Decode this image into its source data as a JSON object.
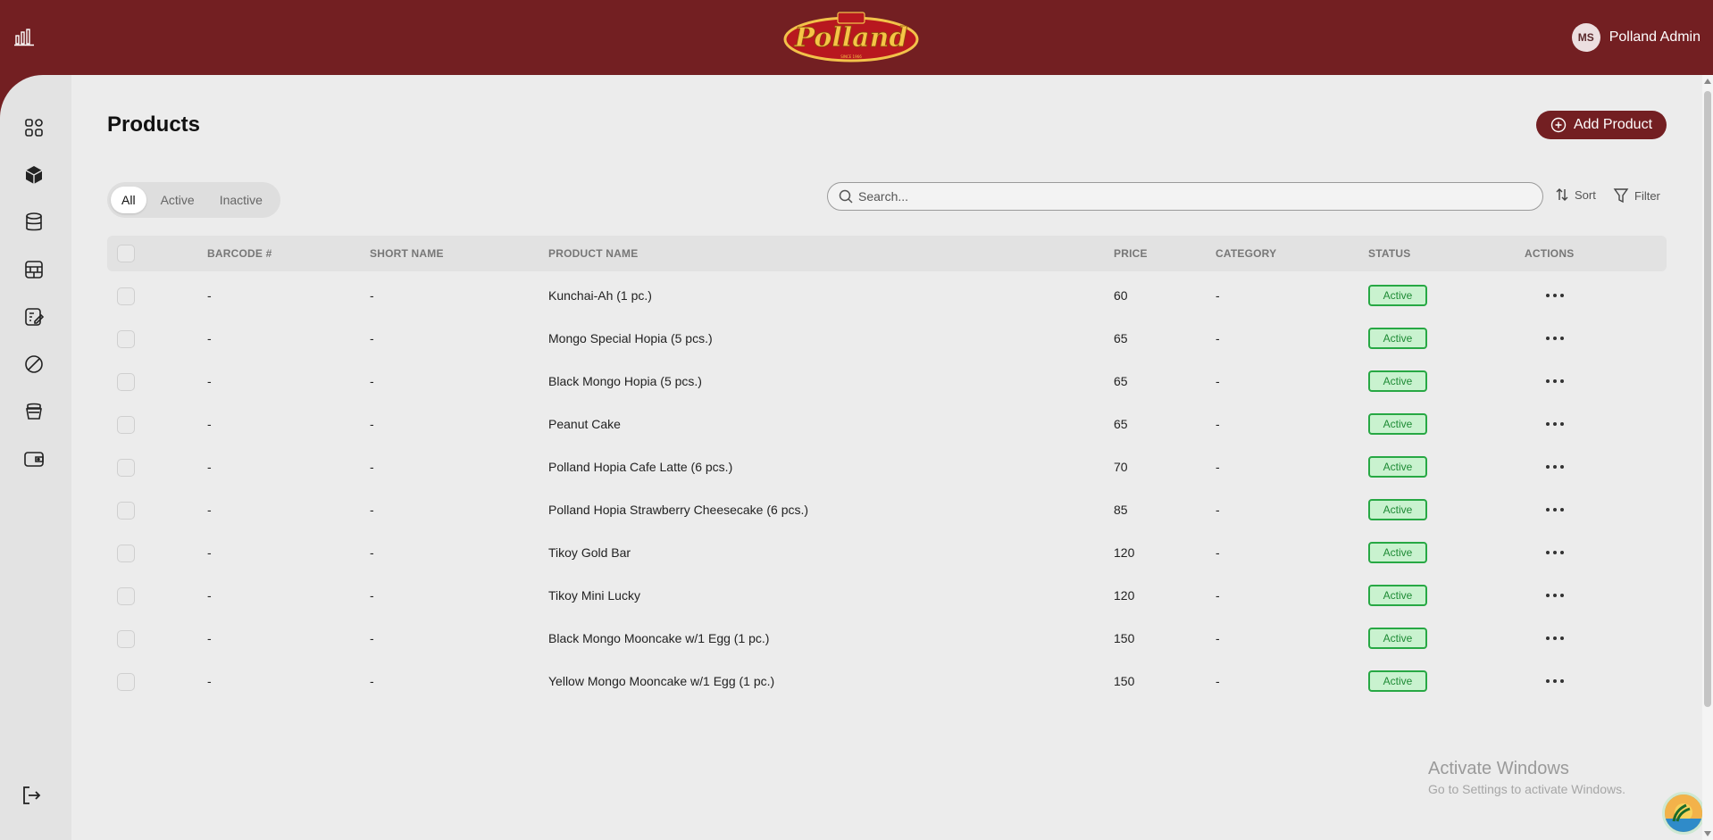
{
  "header": {
    "logo_alt": "Polland",
    "user": {
      "initials": "MS",
      "name": "Polland Admin"
    }
  },
  "sidebar": {
    "items": [
      {
        "icon": "dashboard-grid-icon"
      },
      {
        "icon": "box-icon"
      },
      {
        "icon": "database-icon"
      },
      {
        "icon": "store-icon"
      },
      {
        "icon": "edit-list-icon"
      },
      {
        "icon": "ban-icon"
      },
      {
        "icon": "basket-icon"
      },
      {
        "icon": "wallet-icon"
      }
    ],
    "logout_icon": "logout-icon"
  },
  "page": {
    "title": "Products",
    "add_button": "Add Product",
    "tabs": [
      "All",
      "Active",
      "Inactive"
    ],
    "active_tab": "All",
    "search_placeholder": "Search...",
    "sort_label": "Sort",
    "filter_label": "Filter"
  },
  "table": {
    "columns": [
      "BARCODE #",
      "SHORT NAME",
      "PRODUCT NAME",
      "PRICE",
      "CATEGORY",
      "STATUS",
      "ACTIONS"
    ],
    "rows": [
      {
        "barcode": "-",
        "short_name": "-",
        "product_name": "Kunchai-Ah (1 pc.)",
        "price": "60",
        "category": "-",
        "status": "Active"
      },
      {
        "barcode": "-",
        "short_name": "-",
        "product_name": "Mongo Special Hopia (5 pcs.)",
        "price": "65",
        "category": "-",
        "status": "Active"
      },
      {
        "barcode": "-",
        "short_name": "-",
        "product_name": "Black Mongo Hopia (5 pcs.)",
        "price": "65",
        "category": "-",
        "status": "Active"
      },
      {
        "barcode": "-",
        "short_name": "-",
        "product_name": "Peanut Cake",
        "price": "65",
        "category": "-",
        "status": "Active"
      },
      {
        "barcode": "-",
        "short_name": "-",
        "product_name": "Polland Hopia Cafe Latte (6 pcs.)",
        "price": "70",
        "category": "-",
        "status": "Active"
      },
      {
        "barcode": "-",
        "short_name": "-",
        "product_name": "Polland Hopia Strawberry Cheesecake (6 pcs.)",
        "price": "85",
        "category": "-",
        "status": "Active"
      },
      {
        "barcode": "-",
        "short_name": "-",
        "product_name": "Tikoy Gold Bar",
        "price": "120",
        "category": "-",
        "status": "Active"
      },
      {
        "barcode": "-",
        "short_name": "-",
        "product_name": "Tikoy Mini Lucky",
        "price": "120",
        "category": "-",
        "status": "Active"
      },
      {
        "barcode": "-",
        "short_name": "-",
        "product_name": "Black Mongo Mooncake w/1 Egg (1 pc.)",
        "price": "150",
        "category": "-",
        "status": "Active"
      },
      {
        "barcode": "-",
        "short_name": "-",
        "product_name": "Yellow Mongo Mooncake w/1 Egg (1 pc.)",
        "price": "150",
        "category": "-",
        "status": "Active"
      }
    ]
  },
  "watermark": {
    "line1": "Activate Windows",
    "line2": "Go to Settings to activate Windows."
  },
  "colors": {
    "brand": "#731f22",
    "status_active_border": "#27a844",
    "status_active_bg": "#c9f2cf"
  }
}
